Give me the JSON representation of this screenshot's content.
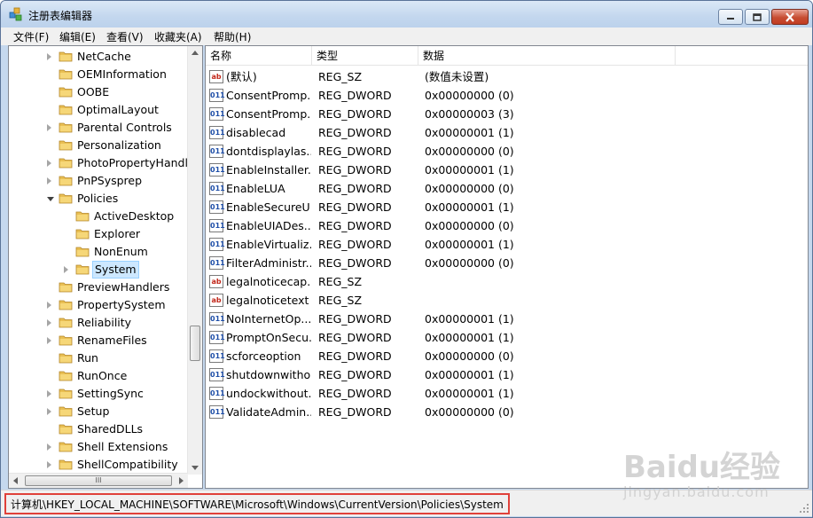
{
  "window": {
    "title": "注册表编辑器",
    "controls": {
      "minimize": "minimize",
      "maximize": "maximize",
      "close": "close"
    }
  },
  "menu": [
    "文件(F)",
    "编辑(E)",
    "查看(V)",
    "收藏夹(A)",
    "帮助(H)"
  ],
  "tree": {
    "items": [
      {
        "label": "NetCache",
        "level": 0,
        "expander": "collapsed"
      },
      {
        "label": "OEMInformation",
        "level": 0,
        "expander": "none"
      },
      {
        "label": "OOBE",
        "level": 0,
        "expander": "none"
      },
      {
        "label": "OptimalLayout",
        "level": 0,
        "expander": "none"
      },
      {
        "label": "Parental Controls",
        "level": 0,
        "expander": "collapsed"
      },
      {
        "label": "Personalization",
        "level": 0,
        "expander": "none"
      },
      {
        "label": "PhotoPropertyHandle",
        "level": 0,
        "expander": "collapsed"
      },
      {
        "label": "PnPSysprep",
        "level": 0,
        "expander": "collapsed"
      },
      {
        "label": "Policies",
        "level": 0,
        "expander": "expanded"
      },
      {
        "label": "ActiveDesktop",
        "level": 1,
        "expander": "none"
      },
      {
        "label": "Explorer",
        "level": 1,
        "expander": "none"
      },
      {
        "label": "NonEnum",
        "level": 1,
        "expander": "none"
      },
      {
        "label": "System",
        "level": 1,
        "expander": "collapsed",
        "selected": true
      },
      {
        "label": "PreviewHandlers",
        "level": 0,
        "expander": "none"
      },
      {
        "label": "PropertySystem",
        "level": 0,
        "expander": "collapsed"
      },
      {
        "label": "Reliability",
        "level": 0,
        "expander": "collapsed"
      },
      {
        "label": "RenameFiles",
        "level": 0,
        "expander": "collapsed"
      },
      {
        "label": "Run",
        "level": 0,
        "expander": "none"
      },
      {
        "label": "RunOnce",
        "level": 0,
        "expander": "none"
      },
      {
        "label": "SettingSync",
        "level": 0,
        "expander": "collapsed"
      },
      {
        "label": "Setup",
        "level": 0,
        "expander": "collapsed"
      },
      {
        "label": "SharedDLLs",
        "level": 0,
        "expander": "none"
      },
      {
        "label": "Shell Extensions",
        "level": 0,
        "expander": "collapsed"
      },
      {
        "label": "ShellCompatibility",
        "level": 0,
        "expander": "collapsed"
      }
    ],
    "hscroll_grip": "III"
  },
  "list": {
    "columns": [
      "名称",
      "类型",
      "数据"
    ],
    "rows": [
      {
        "icon": "sz",
        "name": "(默认)",
        "type": "REG_SZ",
        "data": "(数值未设置)"
      },
      {
        "icon": "dw",
        "name": "ConsentPromp...",
        "type": "REG_DWORD",
        "data": "0x00000000 (0)"
      },
      {
        "icon": "dw",
        "name": "ConsentPromp...",
        "type": "REG_DWORD",
        "data": "0x00000003 (3)"
      },
      {
        "icon": "dw",
        "name": "disablecad",
        "type": "REG_DWORD",
        "data": "0x00000001 (1)"
      },
      {
        "icon": "dw",
        "name": "dontdisplaylas...",
        "type": "REG_DWORD",
        "data": "0x00000000 (0)"
      },
      {
        "icon": "dw",
        "name": "EnableInstaller...",
        "type": "REG_DWORD",
        "data": "0x00000001 (1)"
      },
      {
        "icon": "dw",
        "name": "EnableLUA",
        "type": "REG_DWORD",
        "data": "0x00000000 (0)"
      },
      {
        "icon": "dw",
        "name": "EnableSecureU...",
        "type": "REG_DWORD",
        "data": "0x00000001 (1)"
      },
      {
        "icon": "dw",
        "name": "EnableUIADes...",
        "type": "REG_DWORD",
        "data": "0x00000000 (0)"
      },
      {
        "icon": "dw",
        "name": "EnableVirtualiz...",
        "type": "REG_DWORD",
        "data": "0x00000001 (1)"
      },
      {
        "icon": "dw",
        "name": "FilterAdministr...",
        "type": "REG_DWORD",
        "data": "0x00000000 (0)"
      },
      {
        "icon": "sz",
        "name": "legalnoticecap...",
        "type": "REG_SZ",
        "data": ""
      },
      {
        "icon": "sz",
        "name": "legalnoticetext",
        "type": "REG_SZ",
        "data": ""
      },
      {
        "icon": "dw",
        "name": "NoInternetOp...",
        "type": "REG_DWORD",
        "data": "0x00000001 (1)"
      },
      {
        "icon": "dw",
        "name": "PromptOnSecu...",
        "type": "REG_DWORD",
        "data": "0x00000001 (1)"
      },
      {
        "icon": "dw",
        "name": "scforceoption",
        "type": "REG_DWORD",
        "data": "0x00000000 (0)"
      },
      {
        "icon": "dw",
        "name": "shutdownwitho...",
        "type": "REG_DWORD",
        "data": "0x00000001 (1)"
      },
      {
        "icon": "dw",
        "name": "undockwithout...",
        "type": "REG_DWORD",
        "data": "0x00000001 (1)"
      },
      {
        "icon": "dw",
        "name": "ValidateAdmin...",
        "type": "REG_DWORD",
        "data": "0x00000000 (0)"
      }
    ]
  },
  "status": {
    "path": "计算机\\HKEY_LOCAL_MACHINE\\SOFTWARE\\Microsoft\\Windows\\CurrentVersion\\Policies\\System",
    "highlight_color": "#e0413a"
  },
  "watermark": {
    "brand": "Baidu经验",
    "sub": "jingyan.baidu.com"
  }
}
